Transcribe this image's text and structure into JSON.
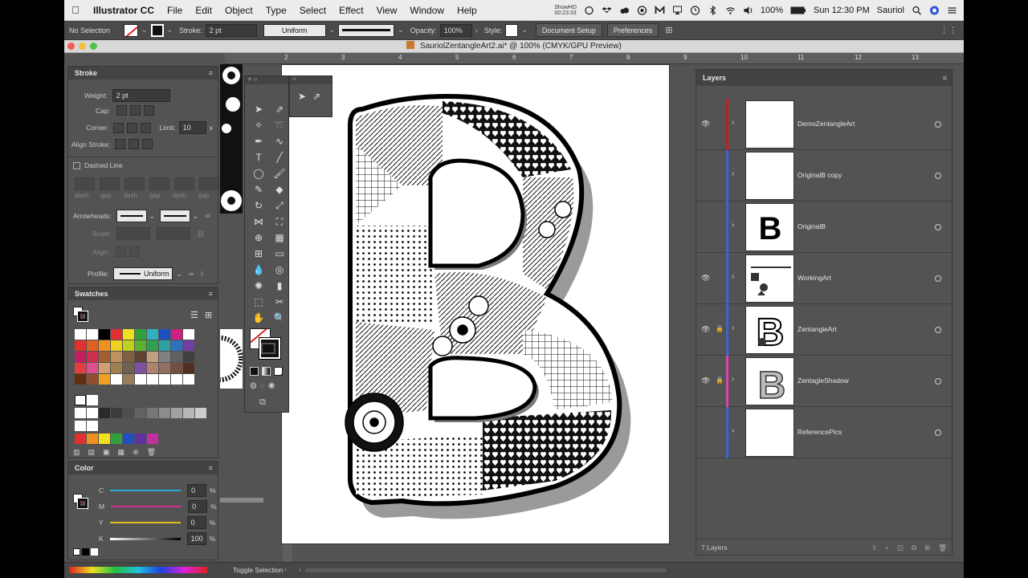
{
  "menubar": {
    "app": "Illustrator CC",
    "items": [
      "File",
      "Edit",
      "Object",
      "Type",
      "Select",
      "Effect",
      "View",
      "Window",
      "Help"
    ],
    "ticks": "ShowHD\n00:23:33",
    "battery": "100%",
    "clock": "Sun 12:30 PM",
    "user": "Sauriol"
  },
  "control": {
    "selection": "No Selection",
    "stroke_label": "Stroke:",
    "stroke_value": "2 pt",
    "profile": "Uniform",
    "opacity_label": "Opacity:",
    "opacity_value": "100%",
    "style_label": "Style:",
    "doc_setup": "Document Setup",
    "preferences": "Preferences"
  },
  "document": {
    "title": "SauriolZentangleArt2.ai* @ 100% (CMYK/GPU Preview)"
  },
  "ruler": {
    "ticks": [
      "2",
      "3",
      "4",
      "5",
      "6",
      "7",
      "8",
      "9",
      "10",
      "11",
      "12",
      "13",
      "14"
    ]
  },
  "stroke_panel": {
    "title": "Stroke",
    "weight_label": "Weight:",
    "weight_value": "2 pt",
    "cap_label": "Cap:",
    "corner_label": "Corner:",
    "limit_label": "Limit:",
    "limit_value": "10",
    "limit_unit": "x",
    "align_label": "Align Stroke:",
    "dashed_label": "Dashed Line",
    "dash_labels": [
      "dash",
      "gap",
      "dash",
      "gap",
      "dash",
      "gap"
    ],
    "arrowheads_label": "Arrowheads:",
    "scale_label": "Scale:",
    "align2_label": "Align:",
    "profile_label": "Profile:",
    "profile_value": "Uniform"
  },
  "swatches_panel": {
    "title": "Swatches",
    "rows": [
      [
        "#ffffff",
        "#ffffff",
        "#000000",
        "#e03030",
        "#f0e020",
        "#33a040",
        "#30b0c0",
        "#2050c0",
        "#d02080",
        "#ffffff"
      ],
      [
        "#e03030",
        "#e06020",
        "#f09020",
        "#f0d020",
        "#c0d020",
        "#60b030",
        "#30a050",
        "#30a0a0",
        "#3070c0",
        "#7040a0"
      ],
      [
        "#c02060",
        "#d03050",
        "#a06030",
        "#c09060",
        "#806040",
        "#604030",
        "#c0a080",
        "#808080",
        "#606060",
        "#404040"
      ],
      [
        "#e04040",
        "#e05090",
        "#d0a070",
        "#a08050",
        "#706050",
        "#8050a0",
        "#b08070",
        "#907060",
        "#705040",
        "#503020"
      ],
      [
        "#603010",
        "#905030",
        "#f0a020",
        "#ffffff",
        "#9a7d5a",
        "#ffffff",
        "#ffffff",
        "#ffffff",
        "#ffffff",
        "#ffffff"
      ]
    ],
    "grays": [
      "#ffffff",
      "#ffffff",
      "#2a2a2a",
      "#3c3c3c",
      "#4e4e4e",
      "#626262",
      "#777777",
      "#8c8c8c",
      "#a2a2a2",
      "#b8b8b8",
      "#cccccc"
    ],
    "bright": [
      "#e03030",
      "#f09020",
      "#f0e020",
      "#33a040",
      "#2050c0",
      "#6030a0",
      "#c030a0"
    ]
  },
  "color_panel": {
    "title": "Color",
    "channels": [
      {
        "label": "C",
        "value": "0",
        "unit": "%"
      },
      {
        "label": "M",
        "value": "0",
        "unit": "%"
      },
      {
        "label": "Y",
        "value": "0",
        "unit": "%"
      },
      {
        "label": "K",
        "value": "100",
        "unit": "%"
      }
    ]
  },
  "layers_panel": {
    "title": "Layers",
    "layers": [
      {
        "name": "DemoZentangleArt",
        "visible": true,
        "locked": false,
        "color": "#c02020"
      },
      {
        "name": "OriginalB copy",
        "visible": false,
        "locked": false,
        "color": "#4060d0"
      },
      {
        "name": "OriginalB",
        "visible": false,
        "locked": false,
        "color": "#4060d0"
      },
      {
        "name": "WorkingArt",
        "visible": true,
        "locked": false,
        "color": "#4060d0"
      },
      {
        "name": "ZentangleArt",
        "visible": true,
        "locked": true,
        "color": "#4060d0"
      },
      {
        "name": "ZentagleShadow",
        "visible": true,
        "locked": true,
        "color": "#e040b0"
      },
      {
        "name": "ReferencePics",
        "visible": false,
        "locked": false,
        "color": "#4060d0"
      }
    ],
    "footer": "7 Layers"
  },
  "status": {
    "text": "Toggle Selection"
  },
  "colors": {
    "panel_bg": "#535353",
    "panel_header": "#434343",
    "artboard": "#ffffff"
  }
}
